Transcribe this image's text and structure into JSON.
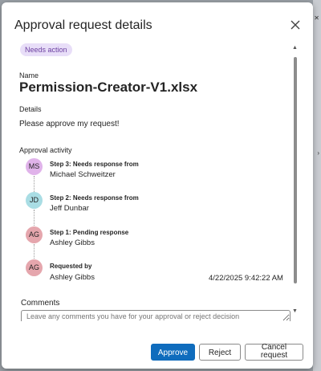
{
  "dialog": {
    "title": "Approval request details",
    "status_badge": "Needs action",
    "name_label": "Name",
    "file_name": "Permission-Creator-V1.xlsx",
    "details_label": "Details",
    "details_text": "Please approve my request!",
    "activity_label": "Approval activity",
    "activity": [
      {
        "initials": "MS",
        "title": "Step 3: Needs response from",
        "person": "Michael Schweitzer",
        "avatar_color": "#e0b3ea"
      },
      {
        "initials": "JD",
        "title": "Step 2: Needs response from",
        "person": "Jeff Dunbar",
        "avatar_color": "#a9dde4"
      },
      {
        "initials": "AG",
        "title": "Step 1: Pending response",
        "person": "Ashley Gibbs",
        "avatar_color": "#e5a6ad"
      },
      {
        "initials": "AG",
        "title": "Requested by",
        "person": "Ashley Gibbs",
        "avatar_color": "#e5a6ad",
        "timestamp": "4/22/2025 9:42:22 AM"
      }
    ],
    "comments_label": "Comments",
    "comments_placeholder": "Leave any comments you have for your approval or reject decision",
    "buttons": {
      "approve": "Approve",
      "reject": "Reject",
      "cancel": "Cancel request"
    }
  },
  "colors": {
    "accent": "#0f6cbd",
    "badge_bg": "#e8def8",
    "badge_text": "#6b3fa0"
  },
  "icons": {
    "close": "close-icon",
    "scroll_up": "chevron-up-icon",
    "scroll_down": "chevron-down-icon"
  }
}
